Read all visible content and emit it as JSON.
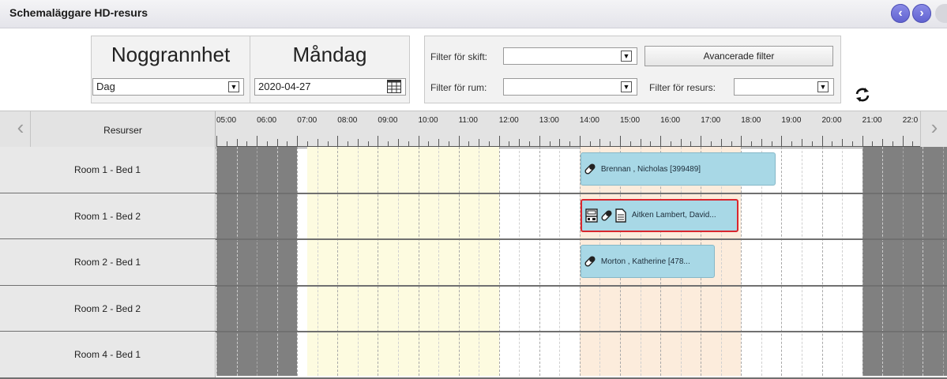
{
  "header": {
    "title": "Schemaläggare HD-resurs",
    "prev_icon": "‹",
    "next_icon": "›"
  },
  "controls": {
    "granularity_title": "Noggrannhet",
    "granularity_value": "Dag",
    "day_title": "Måndag",
    "date_value": "2020-04-27",
    "shift_filter_label": "Filter för skift:",
    "shift_filter_value": "",
    "room_filter_label": "Filter för rum:",
    "room_filter_value": "",
    "advanced_filter_label": "Avancerade filter",
    "resource_filter_label": "Filter för resurs:",
    "resource_filter_value": ""
  },
  "grid": {
    "resources_header": "Resurser",
    "hours": [
      "05:00",
      "06:00",
      "07:00",
      "08:00",
      "09:00",
      "10:00",
      "11:00",
      "12:00",
      "13:00",
      "14:00",
      "15:00",
      "16:00",
      "17:00",
      "18:00",
      "19:00",
      "20:00",
      "21:00",
      "22:0"
    ],
    "rows": [
      {
        "label": "Room 1 - Bed 1"
      },
      {
        "label": "Room 1 - Bed 2"
      },
      {
        "label": "Room 2 - Bed 1"
      },
      {
        "label": "Room 2 - Bed 2"
      },
      {
        "label": "Room 4 - Bed 1"
      }
    ],
    "appointments": [
      {
        "row": 0,
        "text": "Brennan , Nicholas [399489]",
        "icons": [
          "syringe-icon"
        ],
        "selected": false,
        "start": "14:00",
        "end": "18:50"
      },
      {
        "row": 1,
        "text": "Aitken Lambert, David...",
        "icons": [
          "machine-icon",
          "syringe-icon",
          "document-icon"
        ],
        "selected": true,
        "start": "14:00",
        "end": "17:55"
      },
      {
        "row": 2,
        "text": "Morton , Katherine [478...",
        "icons": [
          "syringe-icon"
        ],
        "selected": false,
        "start": "14:00",
        "end": "17:20"
      }
    ]
  },
  "colors": {
    "closed": "#808080",
    "morning_shift": "#fdfbe0",
    "afternoon_shift": "#fcecdc",
    "appointment": "#a8d8e6",
    "selected_border": "#d9262e"
  }
}
